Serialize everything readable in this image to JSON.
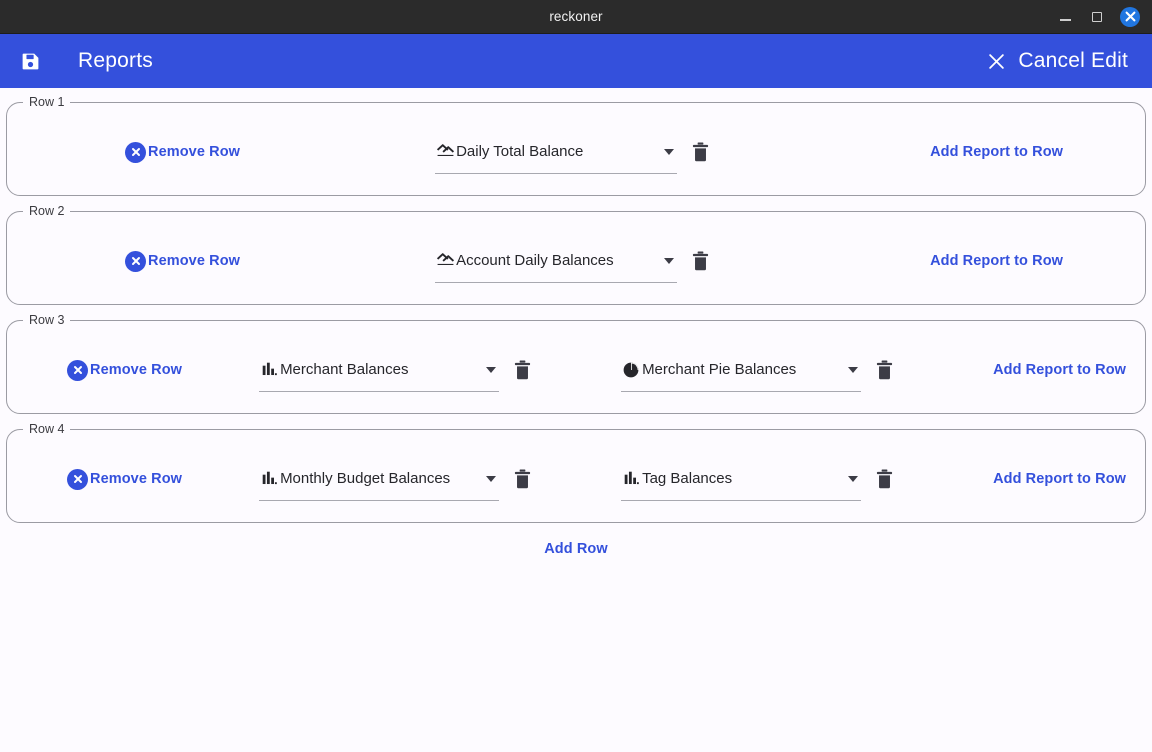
{
  "window": {
    "title": "reckoner",
    "controls": {
      "minimize": "minimize-icon",
      "maximize": "maximize-icon",
      "close": "close-icon"
    }
  },
  "appbar": {
    "save_icon": "save-icon",
    "title": "Reports",
    "cancel_icon": "close-x-icon",
    "cancel_label": "Cancel Edit"
  },
  "labels": {
    "remove_row": "Remove Row",
    "add_report_to_row": "Add Report to Row",
    "add_row": "Add Row",
    "delete_icon": "trash-icon",
    "dropdown_arrow": "chevron-down-icon",
    "remove_icon": "circle-x-icon"
  },
  "colors": {
    "accent_blue": "#3450dc",
    "titlebar_bg": "#2b2b2b",
    "close_button_blue": "#2176e0",
    "page_bg": "#fdfbff",
    "border_gray": "#9b9ba3",
    "underline_gray": "#a8a8b0",
    "icon_dark": "#3c3c46"
  },
  "rows": [
    {
      "legend": "Row 1",
      "reports": [
        {
          "label": "Daily Total Balance",
          "icon": "line-chart-icon"
        }
      ]
    },
    {
      "legend": "Row 2",
      "reports": [
        {
          "label": "Account Daily Balances",
          "icon": "line-chart-icon"
        }
      ]
    },
    {
      "legend": "Row 3",
      "reports": [
        {
          "label": "Merchant Balances",
          "icon": "bar-chart-icon"
        },
        {
          "label": "Merchant Pie Balances",
          "icon": "pie-chart-icon"
        }
      ]
    },
    {
      "legend": "Row 4",
      "reports": [
        {
          "label": "Monthly Budget Balances",
          "icon": "bar-chart-icon"
        },
        {
          "label": "Tag Balances",
          "icon": "bar-chart-icon"
        }
      ]
    }
  ]
}
